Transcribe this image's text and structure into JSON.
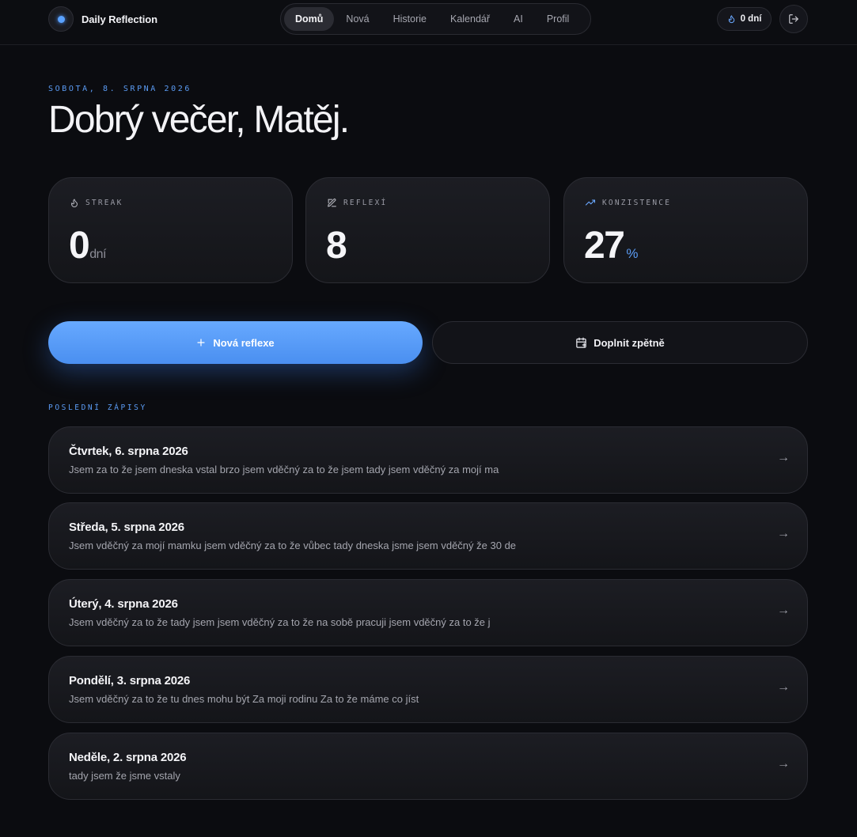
{
  "app": {
    "name": "Daily Reflection",
    "accent": "#5b9cf5"
  },
  "nav": {
    "items": [
      {
        "label": "Domů",
        "active": true
      },
      {
        "label": "Nová",
        "active": false
      },
      {
        "label": "Historie",
        "active": false
      },
      {
        "label": "Kalendář",
        "active": false
      },
      {
        "label": "AI",
        "active": false
      },
      {
        "label": "Profil",
        "active": false
      }
    ]
  },
  "header": {
    "streak_pill": "0 dní",
    "date": "SOBOTA, 8. SRPNA 2026",
    "greeting": "Dobrý večer, Matěj."
  },
  "stats": {
    "streak": {
      "label": "STREAK",
      "value": "0",
      "unit": "dní",
      "icon": "flame-icon"
    },
    "reflections": {
      "label": "REFLEXÍ",
      "value": "8",
      "icon": "note-edit-icon"
    },
    "consistency": {
      "label": "KONZISTENCE",
      "value": "27",
      "unit": "%",
      "icon": "trending-up-icon"
    }
  },
  "actions": {
    "new_reflection": "Nová reflexe",
    "backfill": "Doplnit zpětně"
  },
  "recent": {
    "label": "POSLEDNÍ ZÁPISY",
    "entries": [
      {
        "title": "Čtvrtek, 6. srpna 2026",
        "text": "Jsem za to že jsem dneska vstal brzo jsem vděčný za to že jsem tady jsem vděčný za mojí ma"
      },
      {
        "title": "Středa, 5. srpna 2026",
        "text": "Jsem vděčný za mojí mamku jsem vděčný za to že vůbec tady dneska jsme jsem vděčný že 30 de"
      },
      {
        "title": "Úterý, 4. srpna 2026",
        "text": "Jsem vděčný za to že tady jsem jsem vděčný za to že na sobě pracuji jsem vděčný za to že j"
      },
      {
        "title": "Pondělí, 3. srpna 2026",
        "text": "Jsem vděčný za to že tu dnes mohu být Za moji rodinu Za to že máme co jíst"
      },
      {
        "title": "Neděle, 2. srpna 2026",
        "text": "tady jsem že jsme vstaly"
      }
    ]
  }
}
